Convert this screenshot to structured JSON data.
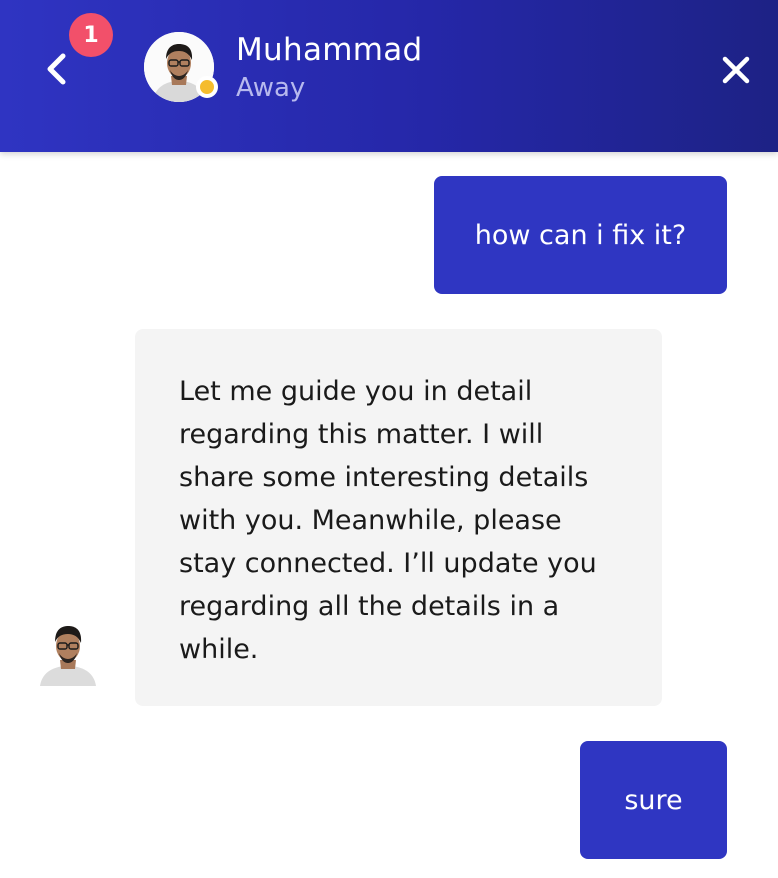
{
  "header": {
    "badge_count": "1",
    "contact_name": "Muhammad",
    "contact_status": "Away",
    "status_color": "#f5bc2d",
    "background": [
      "#2f34c2",
      "#1d2285"
    ],
    "back_icon": "chevron-left-icon",
    "close_icon": "close-icon"
  },
  "messages": [
    {
      "direction": "outgoing",
      "text": "how can i fix it?"
    },
    {
      "direction": "incoming",
      "text": "Let me guide you in detail regarding this matter. I will share some interesting details with you. Meanwhile, please stay connected. I’ll update you regarding all the details in a while."
    },
    {
      "direction": "outgoing",
      "text": "sure"
    }
  ],
  "colors": {
    "outgoing_bubble": "#2f36c2",
    "incoming_bubble": "#f4f4f4",
    "badge": "#f2506a"
  }
}
